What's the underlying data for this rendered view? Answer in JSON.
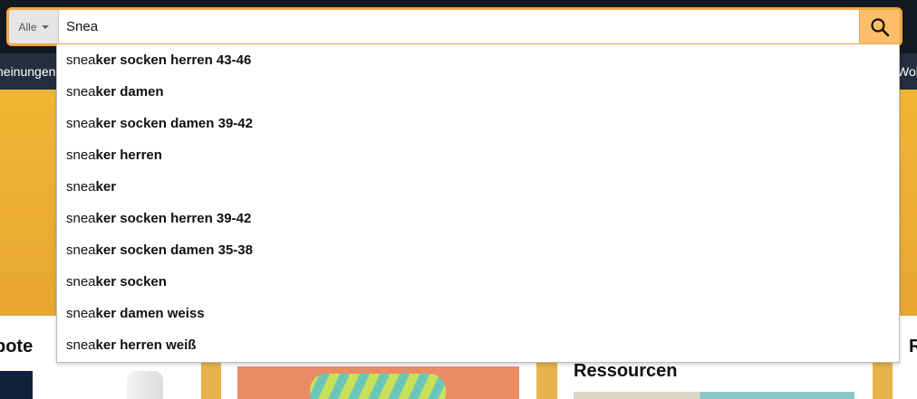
{
  "search": {
    "category": "Alle",
    "value": "Snea"
  },
  "nav": {
    "left_fragment": "heinungen",
    "right_fragment": "Woh"
  },
  "cards": {
    "card1_title_fragment": "bote",
    "card3_title": "Ressourcen",
    "card4_title_fragment": "R"
  },
  "suggestions": [
    {
      "prefix": "snea",
      "rest": "ker socken herren 43-46"
    },
    {
      "prefix": "snea",
      "rest": "ker damen"
    },
    {
      "prefix": "snea",
      "rest": "ker socken damen 39-42"
    },
    {
      "prefix": "snea",
      "rest": "ker herren"
    },
    {
      "prefix": "snea",
      "rest": "ker"
    },
    {
      "prefix": "snea",
      "rest": "ker socken herren 39-42"
    },
    {
      "prefix": "snea",
      "rest": "ker socken damen 35-38"
    },
    {
      "prefix": "snea",
      "rest": "ker socken"
    },
    {
      "prefix": "snea",
      "rest": "ker damen weiss"
    },
    {
      "prefix": "snea",
      "rest": "ker herren weiß"
    }
  ],
  "colors": {
    "header_bg": "#131921",
    "nav_bg": "#232f3e",
    "search_button": "#febd69",
    "focus_border": "#f3a847",
    "hero": "#f2b635"
  },
  "icons": {
    "search_button": "magnifier-icon",
    "category_caret": "caret-down-icon"
  }
}
